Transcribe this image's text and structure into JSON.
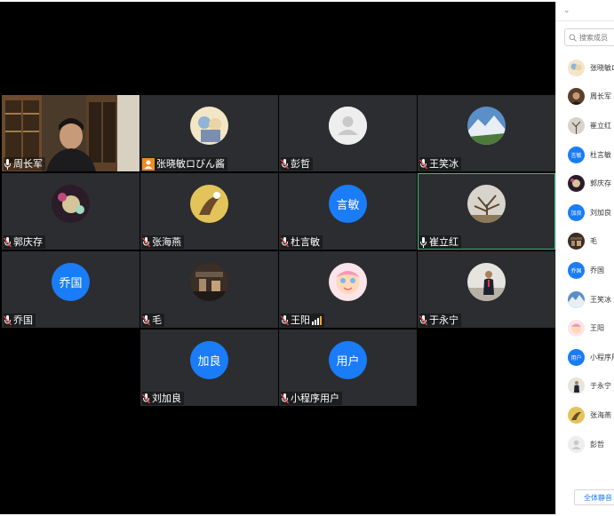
{
  "video_grid": {
    "tiles": [
      {
        "name": "周长军",
        "kind": "video"
      },
      {
        "name": "张晓敏ロびん酱",
        "kind": "avatar"
      },
      {
        "name": "彭哲",
        "kind": "avatar"
      },
      {
        "name": "王笑冰",
        "kind": "avatar"
      },
      {
        "name": "郭庆存",
        "kind": "avatar"
      },
      {
        "name": "张海燕",
        "kind": "avatar"
      },
      {
        "name": "杜言敏",
        "kind": "initials",
        "initials": "言敏"
      },
      {
        "name": "崔立红",
        "kind": "avatar",
        "active": true
      },
      {
        "name": "乔国",
        "kind": "initials",
        "initials": "乔国"
      },
      {
        "name": "毛",
        "kind": "avatar"
      },
      {
        "name": "王阳",
        "kind": "avatar"
      },
      {
        "name": "于永宁",
        "kind": "avatar"
      },
      {
        "name": "刘加良",
        "kind": "initials",
        "initials": "加良"
      },
      {
        "name": "小程序用户",
        "kind": "initials",
        "initials": "用户"
      }
    ]
  },
  "side_panel": {
    "search_placeholder": "搜索成员",
    "members": [
      {
        "name": "张晓敏ロ"
      },
      {
        "name": "周长军"
      },
      {
        "name": "崔立红"
      },
      {
        "name": "杜言敏",
        "initials": "言敏"
      },
      {
        "name": "郭庆存"
      },
      {
        "name": "刘加良",
        "initials": "加良"
      },
      {
        "name": "毛"
      },
      {
        "name": "乔国",
        "initials": "乔国"
      },
      {
        "name": "王笑冰"
      },
      {
        "name": "王阳"
      },
      {
        "name": "小程序用",
        "initials": "用户"
      },
      {
        "name": "于永宁"
      },
      {
        "name": "张海燕"
      },
      {
        "name": "彭哲"
      }
    ],
    "mute_all_label": "全体静音"
  },
  "colors": {
    "tile_bg": "#2c2d30",
    "accent_blue": "#1a7cf7",
    "active_border": "#35c07a",
    "host_badge": "#f08a24"
  }
}
